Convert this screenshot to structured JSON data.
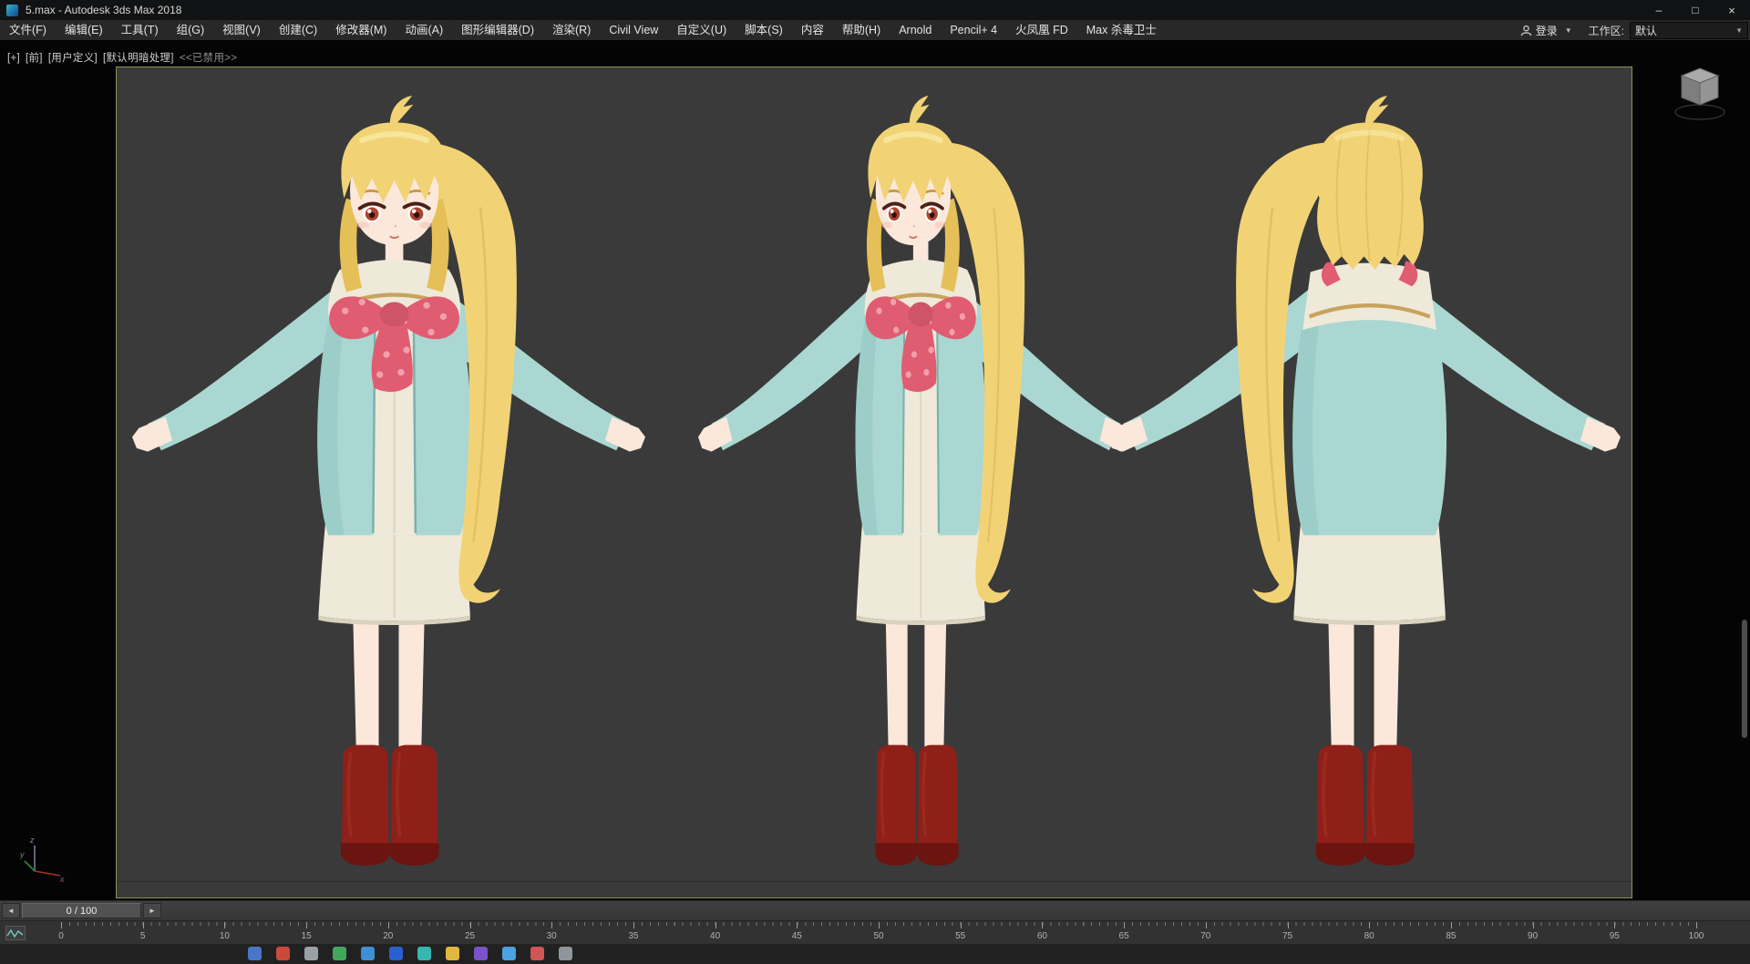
{
  "window": {
    "title": "5.max - Autodesk 3ds Max 2018",
    "minimize_glyph": "–",
    "maximize_glyph": "□",
    "close_glyph": "×"
  },
  "menu_bar": {
    "items": [
      "文件(F)",
      "编辑(E)",
      "工具(T)",
      "组(G)",
      "视图(V)",
      "创建(C)",
      "修改器(M)",
      "动画(A)",
      "图形编辑器(D)",
      "渲染(R)",
      "Civil View",
      "自定义(U)",
      "脚本(S)",
      "内容",
      "帮助(H)",
      "Arnold",
      "Pencil+ 4",
      "火凤凰 FD",
      "Max 杀毒卫士"
    ],
    "login_label": "登录",
    "login_caret": "▼",
    "workspace_label": "工作区:",
    "workspace_value": "默认",
    "workspace_caret": "▼"
  },
  "viewport": {
    "label_segments": [
      "[+]",
      "[前]",
      "[用户定义]",
      "[默认明暗处理]",
      "<<已禁用>>"
    ],
    "axis": {
      "x": "x",
      "y": "y",
      "z": "z"
    }
  },
  "timeline": {
    "slider_value": "0 / 100",
    "prev_glyph": "◄",
    "next_glyph": "►",
    "ruler_labels": [
      "0",
      "5",
      "10",
      "15",
      "20",
      "25",
      "30",
      "35",
      "40",
      "45",
      "50",
      "55",
      "60",
      "65",
      "70",
      "75",
      "80",
      "85",
      "90",
      "95",
      "100"
    ]
  },
  "colors": {
    "plane_background": "#3a3a3a",
    "plane_edge": "#90905a",
    "viewport_background": "#040404"
  },
  "figure_palette": {
    "hair": "#f1d376",
    "hair_shadow": "#e5c058",
    "hair_line": "#d8ae47",
    "hair_highlight": "#f9ecab",
    "skin": "#fbe8da",
    "skin_shadow": "#f2d3bf",
    "teal": "#aad7d2",
    "teal_shadow": "#8bc2bc",
    "teal_line": "#79b1ab",
    "cream": "#efe9da",
    "cream_shadow": "#d9d2bd",
    "trim": "#c8a35c",
    "pink": "#e05c71",
    "pink_dot": "#efa0ab",
    "boot": "#8e2019",
    "boot_dark": "#6c140f",
    "boot_highlight": "#a53127",
    "iris": "#b0432e",
    "lash": "#4c2016",
    "brow": "#c9963f"
  },
  "taskbar": {
    "icon_colors": [
      "#4a76c9",
      "#c94a3a",
      "#9aa0a6",
      "#3fa85c",
      "#3f8fd6",
      "#2a5fd0",
      "#35b8b0",
      "#e0b73f",
      "#7a52c9",
      "#4aa3e0",
      "#d05555",
      "#8f959a"
    ]
  }
}
